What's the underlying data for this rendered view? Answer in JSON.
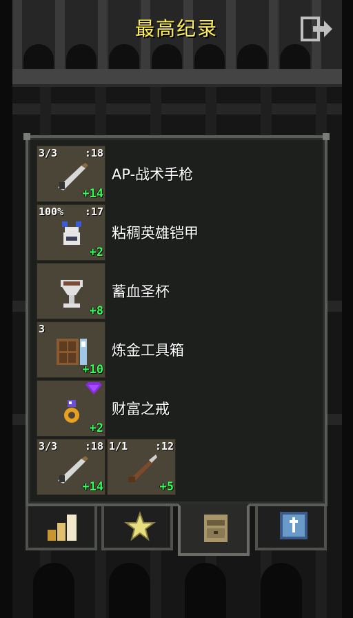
{
  "header": {
    "title": "最高纪录",
    "exit_icon": "exit-door-icon"
  },
  "items": [
    {
      "name": "AP-战术手枪",
      "tl": "3/3",
      "tr": ":18",
      "bonus": "+14",
      "icon": "tactical-pistol-icon"
    },
    {
      "name": "粘稠英雄铠甲",
      "tl": "100%",
      "tr": ":17",
      "bonus": "+2",
      "icon": "hero-armor-icon"
    },
    {
      "name": "蓄血圣杯",
      "tl": "",
      "tr": "",
      "bonus": "+8",
      "icon": "chalice-icon"
    },
    {
      "name": "炼金工具箱",
      "tl": "3",
      "tr": "",
      "bonus": "+10",
      "icon": "alchemy-toolkit-icon"
    },
    {
      "name": "财富之戒",
      "tl": "",
      "tr": "",
      "bonus": "+2",
      "icon": "ring-of-wealth-icon",
      "badge": "purple-gem-icon"
    }
  ],
  "quickslots": [
    {
      "tl": "3/3",
      "tr": ":18",
      "bonus": "+14",
      "icon": "tactical-pistol-icon"
    },
    {
      "tl": "1/1",
      "tr": ":12",
      "bonus": "+5",
      "icon": "rifle-icon"
    }
  ],
  "tabs": [
    {
      "icon": "stats-bars-icon",
      "active": false
    },
    {
      "icon": "star-badges-icon",
      "active": false
    },
    {
      "icon": "backpack-icon",
      "active": true
    },
    {
      "icon": "journal-icon",
      "active": false
    }
  ],
  "colors": {
    "title": "#ffee55",
    "bonus": "#33ff55",
    "slot_bg": "#4a4536",
    "panel_bg": "#1d1f1d"
  }
}
